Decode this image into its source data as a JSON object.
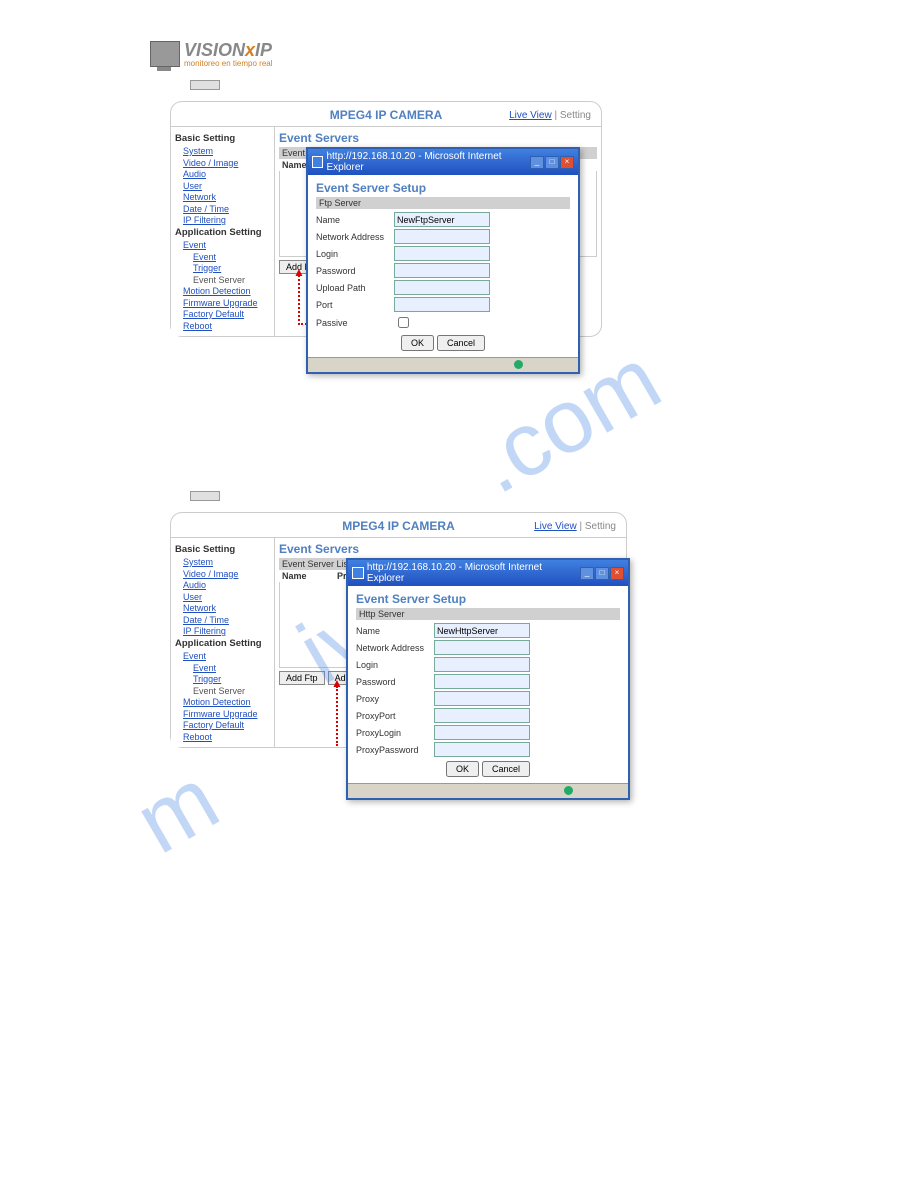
{
  "logo": {
    "main": "VISION",
    "x": "x",
    "ip": "IP",
    "sub": "monitoreo en tiempo real"
  },
  "watermark": "manualshive.com",
  "btn1": "",
  "btn2": "",
  "camera": {
    "title": "MPEG4 IP CAMERA",
    "live_view": "Live View",
    "sep": "|",
    "setting": "Setting"
  },
  "sidebar": {
    "basic": "Basic Setting",
    "items1": [
      "System",
      "Video / Image",
      "Audio",
      "User",
      "Network",
      "Date / Time",
      "IP Filtering"
    ],
    "app": "Application Setting",
    "event": "Event",
    "subs": [
      "Event",
      "Trigger"
    ],
    "server_plain": "Event Server",
    "items2": [
      "Motion Detection",
      "Firmware Upgrade",
      "Factory Default",
      "Reboot"
    ]
  },
  "main": {
    "title": "Event Servers",
    "list": "Event Server List",
    "col_name": "Name",
    "col_proto": "Protocol",
    "add_ftp": "Add Ftp",
    "add_http": "Add Http"
  },
  "popup": {
    "titlebar": "http://192.168.10.20 - Microsoft Internet Explorer",
    "heading": "Event Server Setup",
    "ftp_sub": "Ftp Server",
    "http_sub": "Http Server",
    "ftp_fields": {
      "name": "Name",
      "name_val": "NewFtpServer",
      "addr": "Network Address",
      "login": "Login",
      "pass": "Password",
      "upload": "Upload Path",
      "port": "Port",
      "passive": "Passive"
    },
    "http_fields": {
      "name": "Name",
      "name_val": "NewHttpServer",
      "addr": "Network Address",
      "login": "Login",
      "pass": "Password",
      "proxy": "Proxy",
      "pport": "ProxyPort",
      "plogin": "ProxyLogin",
      "ppass": "ProxyPassword"
    },
    "ok": "OK",
    "cancel": "Cancel"
  }
}
